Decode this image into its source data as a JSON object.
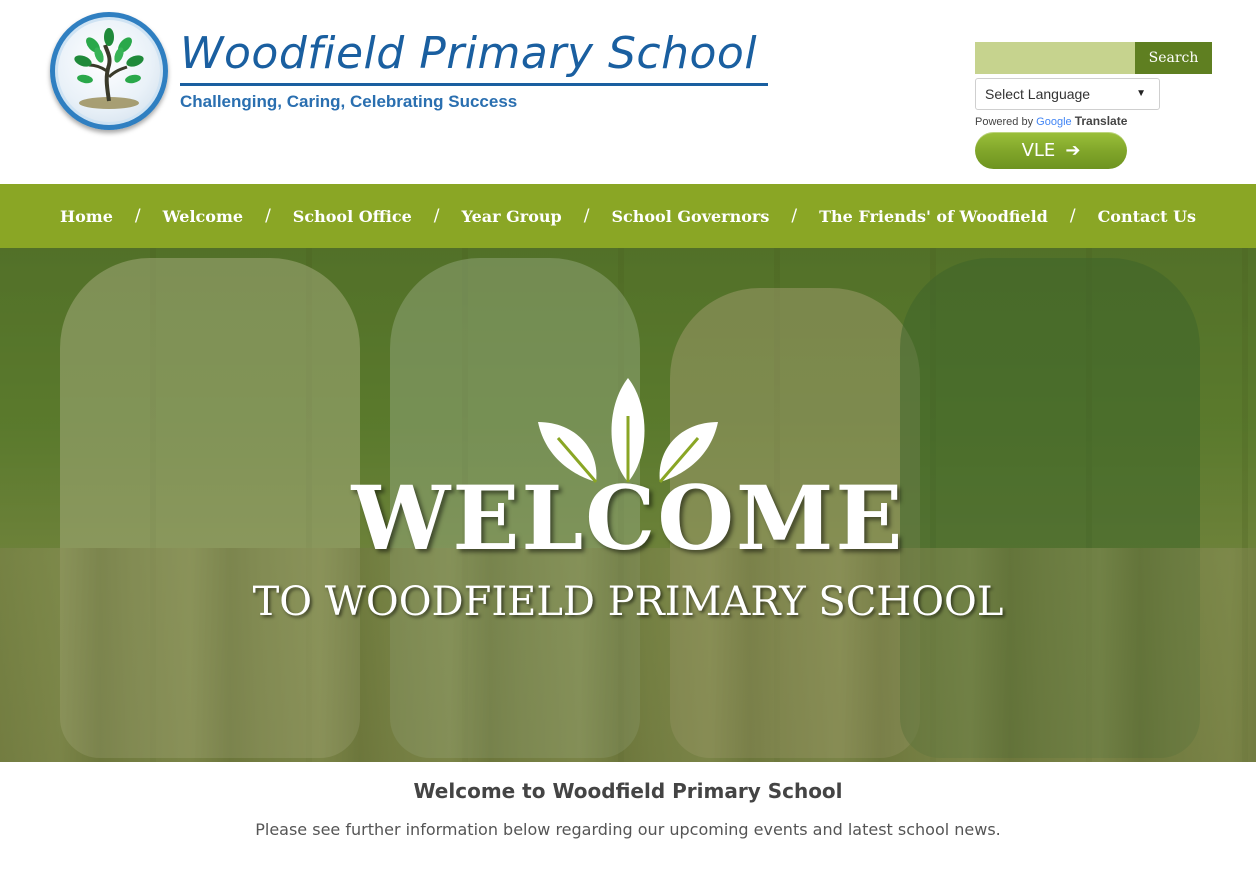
{
  "header": {
    "school_name": "Woodfield Primary School",
    "motto": "Challenging, Caring, Celebrating Success",
    "logo_icon": "tree-logo-icon"
  },
  "search": {
    "placeholder": "",
    "button_label": "Search"
  },
  "translate": {
    "select_label": "Select Language",
    "powered_by": "Powered by",
    "google": "Google",
    "translate": "Translate"
  },
  "vle": {
    "label": "VLE",
    "arrow": "➔"
  },
  "nav": {
    "separator": "/",
    "items": [
      {
        "label": "Home"
      },
      {
        "label": "Welcome"
      },
      {
        "label": "School Office"
      },
      {
        "label": "Year Group"
      },
      {
        "label": "School Governors"
      },
      {
        "label": "The Friends' of Woodfield"
      },
      {
        "label": "Contact Us"
      }
    ]
  },
  "hero": {
    "title": "WELCOME",
    "subtitle": "TO WOODFIELD PRIMARY SCHOOL",
    "icon": "leaf-sprout-icon"
  },
  "content": {
    "heading": "Welcome to Woodfield Primary School",
    "text": "Please see further information below regarding our upcoming events and latest school news."
  },
  "colors": {
    "brand_blue": "#1a5fa0",
    "nav_green": "#8aa625",
    "search_green": "#5f7f21",
    "search_field": "#c6d38e"
  }
}
